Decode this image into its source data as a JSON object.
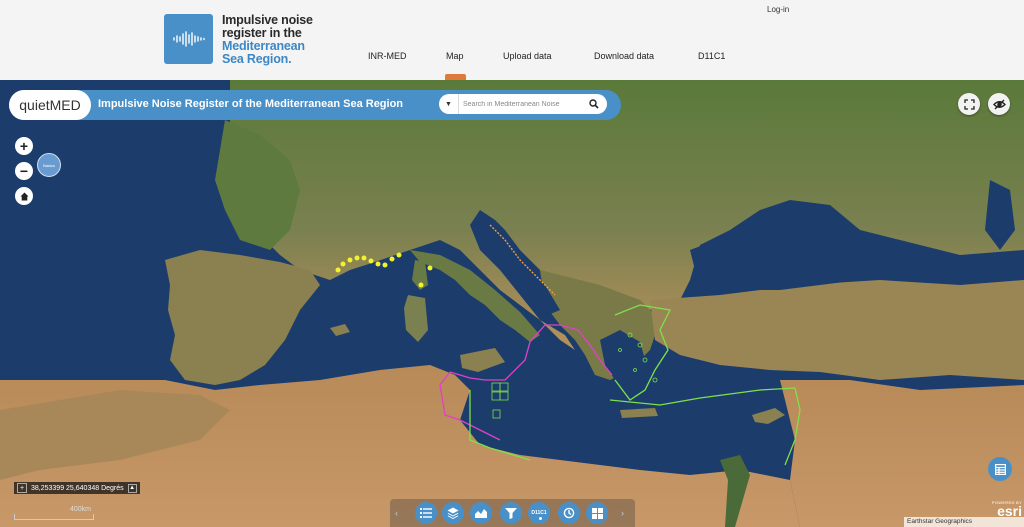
{
  "header": {
    "logo_lines": [
      "Impulsive noise",
      "register in the",
      "Mediterranean",
      "Sea Region."
    ],
    "login": "Log-in",
    "nav": [
      {
        "label": "INR-MED",
        "active": false
      },
      {
        "label": "Map",
        "active": true
      },
      {
        "label": "Upload data",
        "active": false
      },
      {
        "label": "Download data",
        "active": false
      },
      {
        "label": "D11C1",
        "active": false
      }
    ]
  },
  "map": {
    "brand": "quietMED",
    "title": "Impulsive Noise Register of the Mediterranean Sea Region",
    "search_placeholder": "Search in Mediterranean Noise",
    "basemap_thumb": "Basics",
    "coordinates": "38,253399 25,640348 Degrés",
    "scale_label": "400km",
    "attribution": "Earthstar Geographics",
    "esri_powered": "POWERED BY",
    "esri_label": "esri",
    "toolbar": [
      "list-icon",
      "layers-icon",
      "chart-icon",
      "filter-icon",
      "d11c1-icon",
      "history-icon",
      "grid-icon"
    ],
    "toolbar_d11c1": "D11C1",
    "colors": {
      "accent": "#4a90c8",
      "nav_active": "#e07a3a",
      "sea": "#1e3f6e",
      "markers_yellow": "#f2f22e",
      "green_zone": "#7ee04a",
      "magenta_zone": "#e040c8",
      "orange_zone": "#f0a040"
    }
  }
}
